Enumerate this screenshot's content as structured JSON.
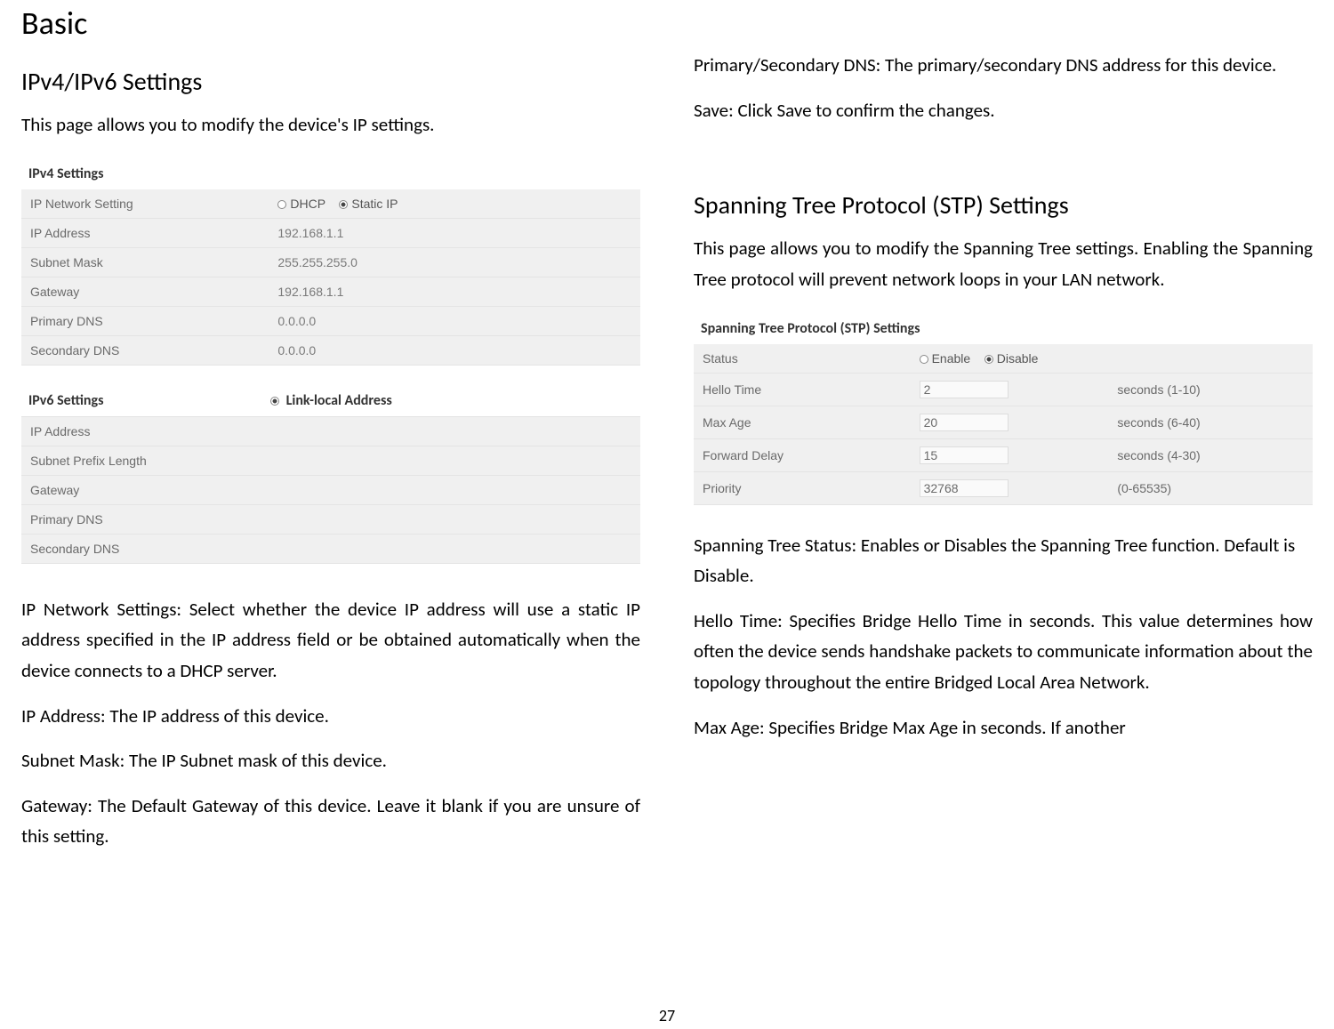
{
  "pageNumber": "27",
  "left": {
    "title": "Basic",
    "subtitle": "IPv4/IPv6 Settings",
    "intro": "This page allows you to modify the device's IP settings.",
    "ipv4": {
      "caption": "IPv4 Settings",
      "rows": [
        {
          "label": "IP Network Setting",
          "type": "radio",
          "opt1": "DHCP",
          "opt2": "Static IP"
        },
        {
          "label": "IP Address",
          "value": "192.168.1.1"
        },
        {
          "label": "Subnet Mask",
          "value": "255.255.255.0"
        },
        {
          "label": "Gateway",
          "value": "192.168.1.1"
        },
        {
          "label": "Primary DNS",
          "value": "0.0.0.0"
        },
        {
          "label": "Secondary DNS",
          "value": "0.0.0.0"
        }
      ]
    },
    "ipv6": {
      "head1": "IPv6 Settings",
      "head2": "Link-local Address",
      "rows": [
        {
          "label": "IP Address"
        },
        {
          "label": "Subnet Prefix Length"
        },
        {
          "label": "Gateway"
        },
        {
          "label": "Primary DNS"
        },
        {
          "label": "Secondary DNS"
        }
      ]
    },
    "paras": [
      "IP Network Settings: Select whether the device IP address will use a static IP address specified in the IP address field or be obtained automatically when the device connects to a DHCP server.",
      "IP Address: The IP address of this device.",
      "Subnet Mask: The IP Subnet mask of this device.",
      "Gateway: The Default Gateway of this device. Leave it blank if you are unsure of this setting."
    ]
  },
  "right": {
    "paras_top": [
      "Primary/Secondary DNS: The primary/secondary DNS address for this device.",
      "Save: Click Save to confirm the changes."
    ],
    "stp_heading": "Spanning Tree Protocol (STP) Settings",
    "stp_intro": "This page allows you to modify the Spanning Tree settings. Enabling the Spanning Tree protocol will prevent network loops in your LAN network.",
    "stp": {
      "caption": "Spanning Tree Protocol (STP) Settings",
      "rows": [
        {
          "label": "Status",
          "type": "radio",
          "opt1": "Enable",
          "opt2": "Disable",
          "hint": ""
        },
        {
          "label": "Hello Time",
          "value": "2",
          "hint": "seconds (1-10)"
        },
        {
          "label": "Max Age",
          "value": "20",
          "hint": "seconds (6-40)"
        },
        {
          "label": "Forward Delay",
          "value": "15",
          "hint": "seconds (4-30)"
        },
        {
          "label": "Priority",
          "value": "32768",
          "hint": "(0-65535)"
        }
      ]
    },
    "paras_bottom": [
      "Spanning Tree Status: Enables or Disables the Spanning Tree function. Default is Disable.",
      "Hello Time: Specifies Bridge Hello Time in seconds. This value determines how often the device sends handshake packets to communicate information about the topology throughout the entire Bridged Local Area Network.",
      "Max Age: Specifies Bridge Max Age in seconds. If another"
    ]
  }
}
